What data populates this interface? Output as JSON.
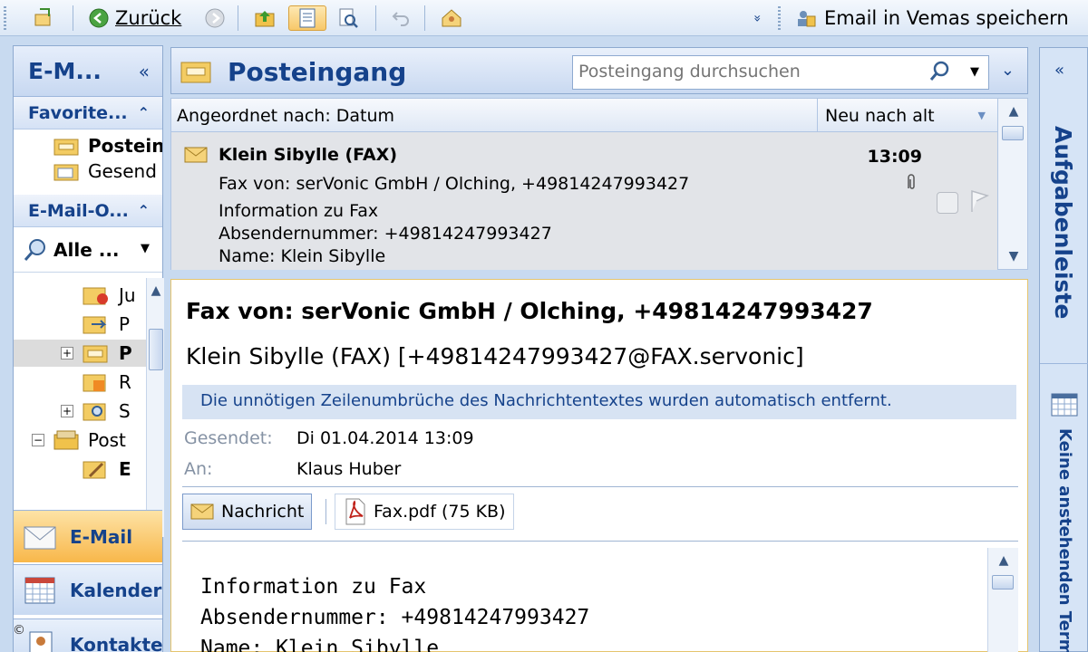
{
  "toolbar": {
    "back_label": "Zurück",
    "vemas_label": "Email in Vemas speichern",
    "overflow_symbol": "»"
  },
  "nav": {
    "title": "E-M...",
    "collapse_symbol": "«",
    "favorites_header": "Favorite...",
    "favorites": [
      {
        "label": "Postein"
      },
      {
        "label": "Gesend"
      }
    ],
    "mail_folders_header": "E-Mail-O...",
    "all_folders_label": "Alle ...",
    "tree": [
      {
        "label": "Ju"
      },
      {
        "label": "P"
      },
      {
        "label": "P"
      },
      {
        "label": "R"
      },
      {
        "label": "S"
      },
      {
        "label": "Post"
      },
      {
        "label": "E"
      }
    ],
    "buttons": {
      "mail": "E-Mail",
      "calendar": "Kalender",
      "contacts": "Kontakte"
    },
    "copyright": "©"
  },
  "inbox": {
    "title": "Posteingang",
    "search_placeholder": "Posteingang durchsuchen",
    "sort_label": "Angeordnet nach: Datum",
    "sort_order": "Neu nach alt"
  },
  "message_list": [
    {
      "from": "Klein Sibylle (FAX)",
      "time": "13:09",
      "subject": "Fax von: serVonic GmbH / Olching, +49814247993427",
      "preview": [
        "Information zu Fax",
        "Absendernummer: +49814247993427",
        "Name: Klein Sibylle"
      ]
    }
  ],
  "reading": {
    "subject": "Fax von: serVonic GmbH / Olching, +49814247993427",
    "sender": "Klein Sibylle (FAX) [+49814247993427@FAX.servonic]",
    "info_bar": "Die unnötigen Zeilenumbrüche des Nachrichtentextes wurden automatisch entfernt.",
    "sent_label": "Gesendet:",
    "sent_value": "Di 01.04.2014 13:09",
    "to_label": "An:",
    "to_value": "Klaus Huber",
    "tab_message": "Nachricht",
    "attachment": "Fax.pdf (75 KB)",
    "body_lines": [
      "Information zu Fax",
      "Absendernummer: +49814247993427",
      "Name: Klein Sibylle"
    ]
  },
  "todo": {
    "title": "Aufgabenleiste",
    "no_tasks": "Keine anstehenden Termine"
  },
  "colors": {
    "accent": "#15428b",
    "active_tab": "#f8b74a",
    "pane_border": "#8eaad0"
  }
}
